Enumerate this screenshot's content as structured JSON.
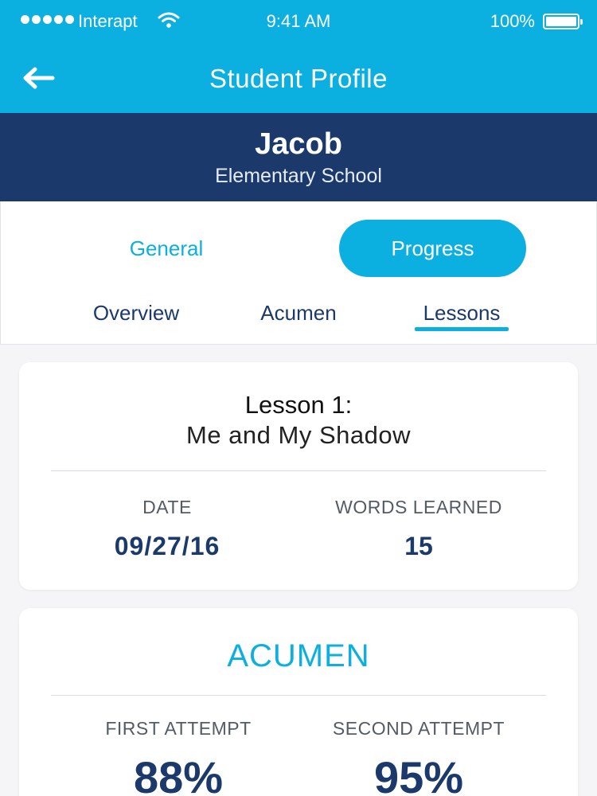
{
  "status_bar": {
    "carrier": "Interapt",
    "time": "9:41 AM",
    "battery": "100%"
  },
  "nav": {
    "title": "Student Profile",
    "back_icon": "arrow-left-icon"
  },
  "student": {
    "name": "Jacob",
    "school": "Elementary School"
  },
  "segments": [
    {
      "label": "General",
      "active": false
    },
    {
      "label": "Progress",
      "active": true
    }
  ],
  "subtabs": [
    {
      "label": "Overview",
      "active": false
    },
    {
      "label": "Acumen",
      "active": false
    },
    {
      "label": "Lessons",
      "active": true
    }
  ],
  "lesson_card": {
    "number": "Lesson 1:",
    "title": "Me and My Shadow",
    "date_label": "DATE",
    "date_value": "09/27/16",
    "words_label": "WORDS LEARNED",
    "words_value": "15"
  },
  "acumen_card": {
    "title": "ACUMEN",
    "first_label": "FIRST ATTEMPT",
    "first_value": "88%",
    "second_label": "SECOND ATTEMPT",
    "second_value": "95%"
  },
  "colors": {
    "accent": "#0bb0e0",
    "navy": "#1b3a6b",
    "background": "#f5f5f7"
  }
}
